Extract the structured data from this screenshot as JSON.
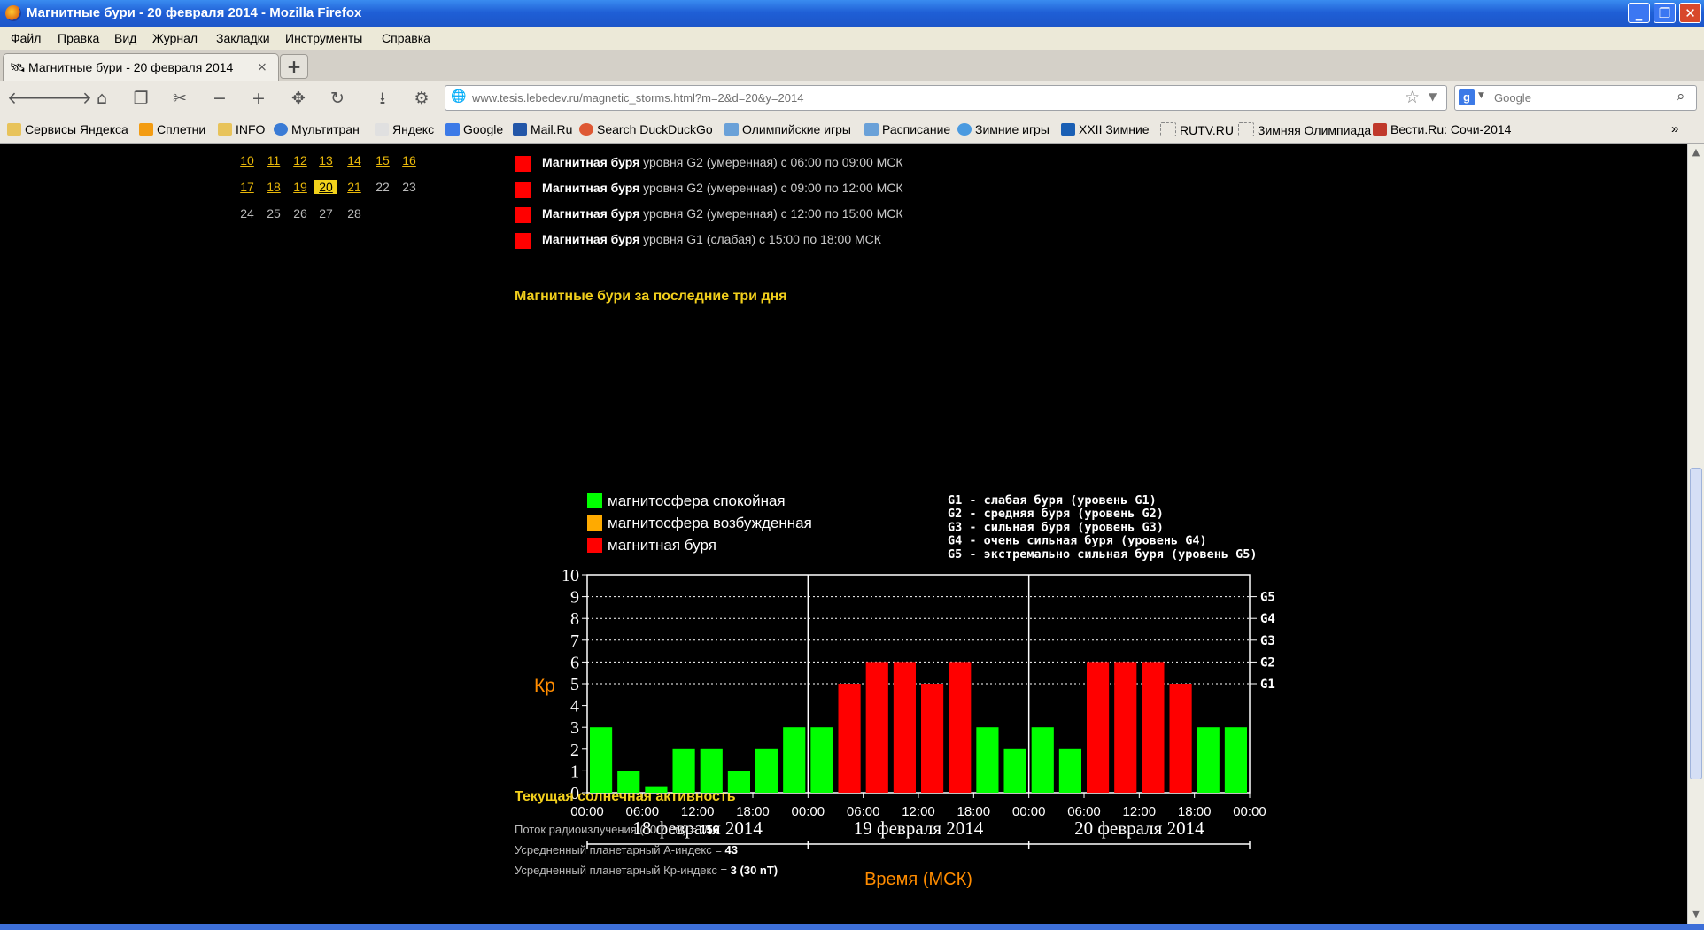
{
  "window": {
    "title": "Магнитные бури - 20 февраля 2014 - Mozilla Firefox"
  },
  "menu": [
    "Файл",
    "Правка",
    "Вид",
    "Журнал",
    "Закладки",
    "Инструменты",
    "Справка"
  ],
  "tab": {
    "label": "Магнитные бури - 20 февраля 2014"
  },
  "address": {
    "url": "www.tesis.lebedev.ru/magnetic_storms.html?m=2&d=20&y=2014"
  },
  "search": {
    "placeholder": "Google"
  },
  "bookmarks": [
    "Сервисы Яндекса",
    "Сплетни",
    "INFO",
    "Мультитран",
    "Яндекс",
    "Google",
    "Mail.Ru",
    "Search DuckDuckGo",
    "Олимпийские игры",
    "Расписание",
    "Зимние игры",
    "XXII Зимние",
    "RUTV.RU",
    "Зимняя Олимпиада",
    "Вести.Ru: Сочи-2014"
  ],
  "calendar": {
    "rows": [
      [
        {
          "d": "10",
          "t": "link"
        },
        {
          "d": "11",
          "t": "link"
        },
        {
          "d": "12",
          "t": "link"
        },
        {
          "d": "13",
          "t": "link"
        },
        {
          "d": "14",
          "t": "link"
        },
        {
          "d": "15",
          "t": "link"
        },
        {
          "d": "16",
          "t": "link"
        }
      ],
      [
        {
          "d": "17",
          "t": "link"
        },
        {
          "d": "18",
          "t": "link"
        },
        {
          "d": "19",
          "t": "link"
        },
        {
          "d": "20",
          "t": "sel"
        },
        {
          "d": "21",
          "t": "link"
        },
        {
          "d": "22",
          "t": "plain"
        },
        {
          "d": "23",
          "t": "plain"
        }
      ],
      [
        {
          "d": "24",
          "t": "plain"
        },
        {
          "d": "25",
          "t": "plain"
        },
        {
          "d": "26",
          "t": "plain"
        },
        {
          "d": "27",
          "t": "plain"
        },
        {
          "d": "28",
          "t": "plain"
        }
      ]
    ]
  },
  "storms": [
    {
      "bold": "Магнитная буря",
      "rest": " уровня  G2 (умеренная) с 06:00 по 09:00 МСК"
    },
    {
      "bold": "Магнитная буря",
      "rest": " уровня  G2 (умеренная) с 09:00 по 12:00 МСК"
    },
    {
      "bold": "Магнитная буря",
      "rest": " уровня  G2 (умеренная) с 12:00 по 15:00 МСК"
    },
    {
      "bold": "Магнитная буря",
      "rest": " уровня  G1 (слабая) с 15:00 по 18:00 МСК"
    }
  ],
  "sections": {
    "three_days": "Магнитные бури за последние три дня",
    "solar": "Текущая солнечная активность"
  },
  "solar": [
    {
      "label": "Поток радиоизлучения (10.7 см) = ",
      "value": "156"
    },
    {
      "label": "Усредненный планетарный А-индекс = ",
      "value": "43"
    },
    {
      "label": "Усредненный планетарный Кр-индекс = ",
      "value": "3 (30 nT)"
    }
  ],
  "colors": {
    "quiet": "#00ff00",
    "excited": "#ffaa00",
    "storm": "#ff0000",
    "accent": "#f2cf1c",
    "axis_label": "#ff8c00"
  },
  "chart_data": {
    "type": "bar",
    "ylabel": "Кр",
    "xlabel": "Время (МСК)",
    "ylim": [
      0,
      10
    ],
    "yticks": [
      0,
      1,
      2,
      3,
      4,
      5,
      6,
      7,
      8,
      9,
      10
    ],
    "g_levels": [
      {
        "label": "G1",
        "y": 5
      },
      {
        "label": "G2",
        "y": 6
      },
      {
        "label": "G3",
        "y": 7
      },
      {
        "label": "G4",
        "y": 8
      },
      {
        "label": "G5",
        "y": 9
      }
    ],
    "legend": [
      {
        "label": "магнитосфера спокойная",
        "color": "#00ff00"
      },
      {
        "label": "магнитосфера возбужденная",
        "color": "#ffaa00"
      },
      {
        "label": "магнитная буря",
        "color": "#ff0000"
      }
    ],
    "g_legend": [
      "G1 - слабая буря (уровень G1)",
      "G2 - средняя буря (уровень G2)",
      "G3 - сильная буря (уровень G3)",
      "G4 - очень сильная буря (уровень G4)",
      "G5 - экстремально сильная буря (уровень G5)"
    ],
    "days": [
      "18 февраля 2014",
      "19 февраля 2014",
      "20 февраля 2014"
    ],
    "time_ticks": [
      "00:00",
      "06:00",
      "12:00",
      "18:00",
      "00:00",
      "06:00",
      "12:00",
      "18:00",
      "00:00",
      "06:00",
      "12:00",
      "18:00",
      "00:00"
    ],
    "values": [
      3,
      1,
      0.3,
      2,
      2,
      1,
      2,
      3,
      3,
      5,
      6,
      6,
      5,
      6,
      3,
      2,
      3,
      2,
      6,
      6,
      6,
      5,
      3,
      3
    ],
    "levels": [
      "quiet",
      "quiet",
      "quiet",
      "quiet",
      "quiet",
      "quiet",
      "quiet",
      "quiet",
      "quiet",
      "storm",
      "storm",
      "storm",
      "storm",
      "storm",
      "quiet",
      "quiet",
      "quiet",
      "quiet",
      "storm",
      "storm",
      "storm",
      "storm",
      "quiet",
      "quiet"
    ]
  }
}
